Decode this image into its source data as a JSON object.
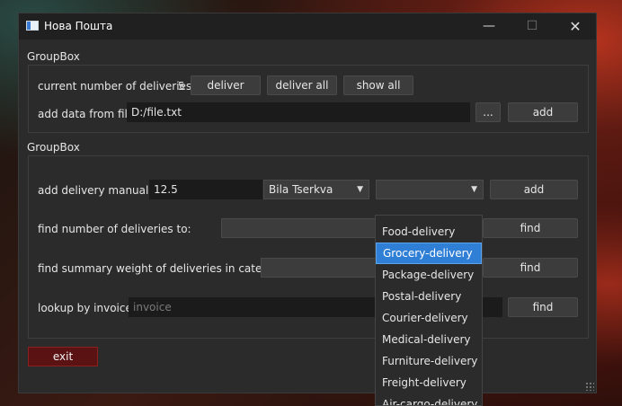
{
  "window": {
    "title": "Нова Пошта",
    "minimize": "—",
    "maximize": "☐",
    "close": "✕"
  },
  "group1": {
    "title": "GroupBox",
    "count_label": "current number of deliveries:",
    "count_value": "5",
    "deliver": "deliver",
    "deliver_all": "deliver all",
    "show_all": "show all",
    "file_label": "add data from file",
    "file_value": "D:/file.txt",
    "browse": "...",
    "add": "add"
  },
  "group2": {
    "title": "GroupBox",
    "manual_label": "add delivery manually:",
    "weight_value": "12.5",
    "city_value": "Bila Tserkva",
    "category_value": "",
    "add": "add",
    "find_to_label": "find number of deliveries to:",
    "find_to_button": "find",
    "summary_label": "find summary weight of deliveries in category:",
    "summary_button": "find",
    "invoice_label": "lookup by invoice:",
    "invoice_placeholder": "invoice",
    "invoice_button": "find"
  },
  "exit": "exit",
  "dropdown": {
    "items": [
      "Food-delivery",
      "Grocery-delivery",
      "Package-delivery",
      "Postal-delivery",
      "Courier-delivery",
      "Medical-delivery",
      "Furniture-delivery",
      "Freight-delivery",
      "Air-cargo-delivery"
    ],
    "selected": "Grocery-delivery"
  },
  "colors": {
    "accent": "#2f7fd6",
    "exit_bg": "#5a1212",
    "window_bg": "#2b2b2b"
  }
}
